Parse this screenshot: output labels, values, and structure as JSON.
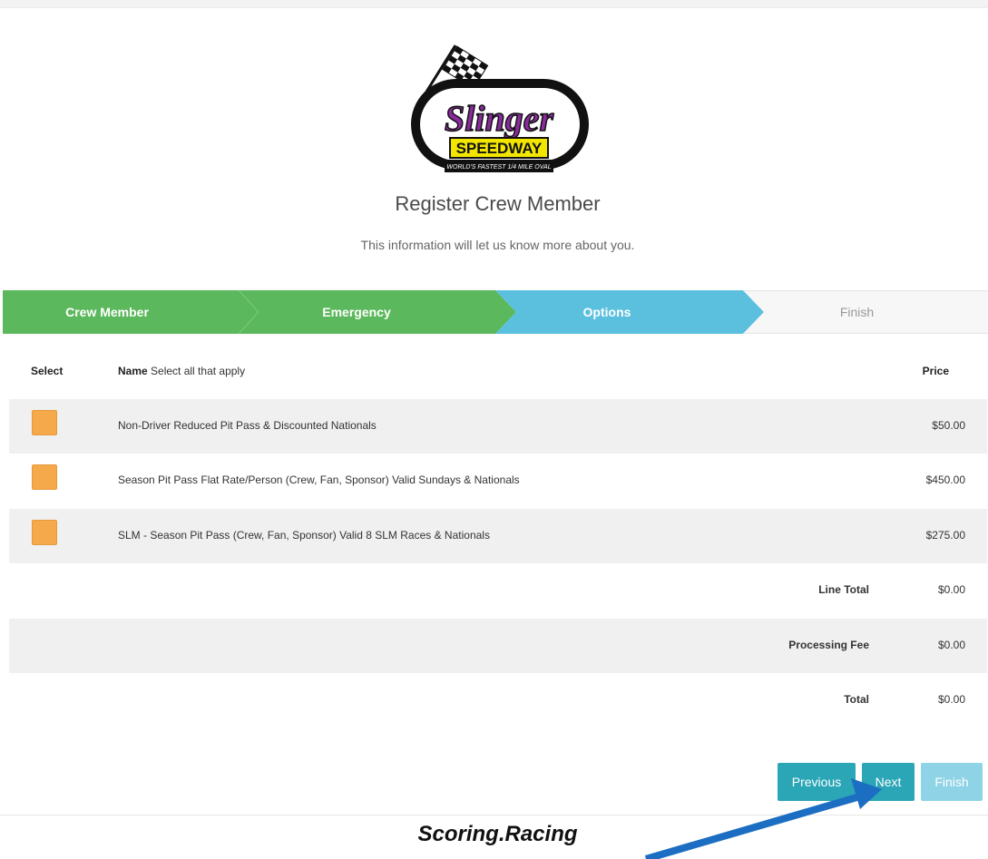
{
  "logo": {
    "brand": "Slinger",
    "sub": "SPEEDWAY",
    "tagline": "WORLD'S FASTEST 1/4 MILE OVAL"
  },
  "header": {
    "title": "Register Crew Member",
    "subtitle": "This information will let us know more about you."
  },
  "wizard": {
    "steps": [
      {
        "label": "Crew Member",
        "state": "completed"
      },
      {
        "label": "Emergency",
        "state": "completed"
      },
      {
        "label": "Options",
        "state": "active"
      },
      {
        "label": "Finish",
        "state": "pending"
      }
    ],
    "colors": {
      "completed": "#5cb85c",
      "active": "#5bc0de",
      "pending": "#f7f7f7",
      "pending_text": "#999999"
    }
  },
  "table": {
    "headers": {
      "select": "Select",
      "name_bold": "Name",
      "name_hint": "Select all that apply",
      "price": "Price"
    },
    "options": [
      {
        "name": "Non-Driver Reduced Pit Pass & Discounted Nationals",
        "price": "$50.00"
      },
      {
        "name": "Season Pit Pass Flat Rate/Person (Crew, Fan, Sponsor) Valid Sundays & Nationals",
        "price": "$450.00"
      },
      {
        "name": "SLM - Season Pit Pass (Crew, Fan, Sponsor) Valid 8 SLM Races & Nationals",
        "price": "$275.00"
      }
    ],
    "totals": [
      {
        "label": "Line Total",
        "value": "$0.00"
      },
      {
        "label": "Processing Fee",
        "value": "$0.00"
      },
      {
        "label": "Total",
        "value": "$0.00"
      }
    ],
    "checkbox_color": "#f5a94a"
  },
  "buttons": {
    "previous": "Previous",
    "next": "Next",
    "finish": "Finish"
  },
  "footer": {
    "brand": "Scoring.Racing"
  },
  "annotation": {
    "icon": "pointer-arrow-icon",
    "color": "#1b6ec2"
  }
}
